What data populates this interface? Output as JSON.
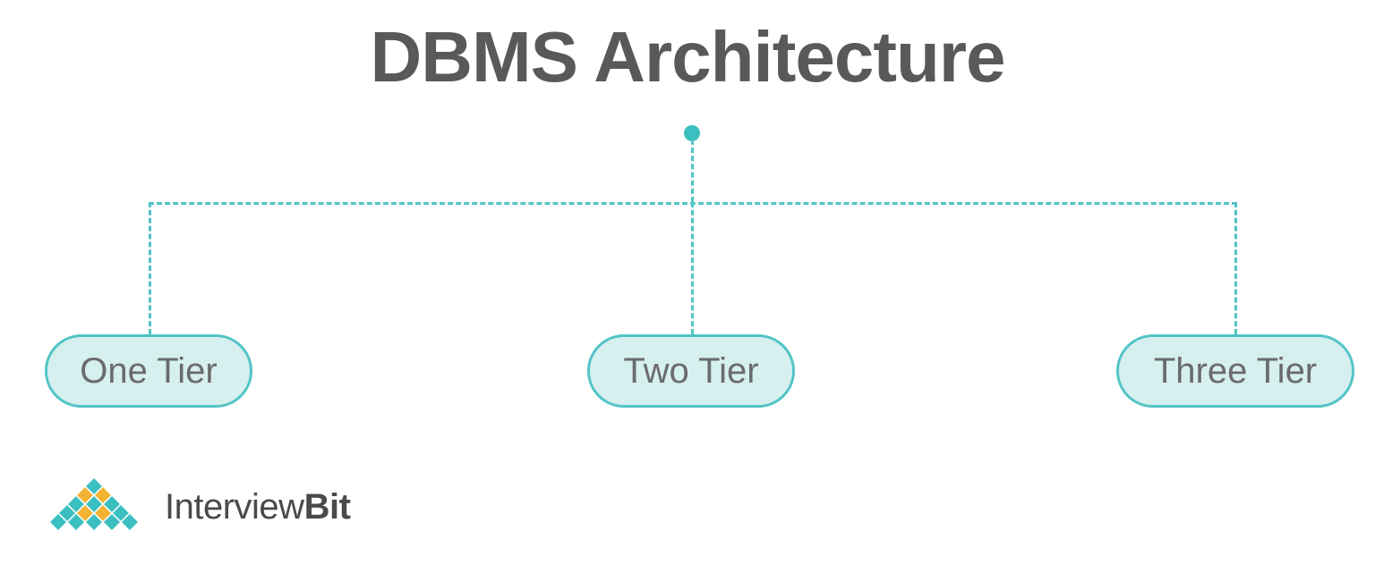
{
  "title": "DBMS Architecture",
  "nodes": {
    "left": "One Tier",
    "mid": "Two Tier",
    "right": "Three Tier"
  },
  "logo": {
    "brand_part1": "Interview",
    "brand_part2": "Bit"
  },
  "colors": {
    "title": "#595959",
    "node_border": "#52c4c6",
    "node_fill": "#d6efef",
    "accent_teal": "#3bbfc1",
    "accent_orange": "#f2b233",
    "text_gray": "#6b6b6b"
  }
}
